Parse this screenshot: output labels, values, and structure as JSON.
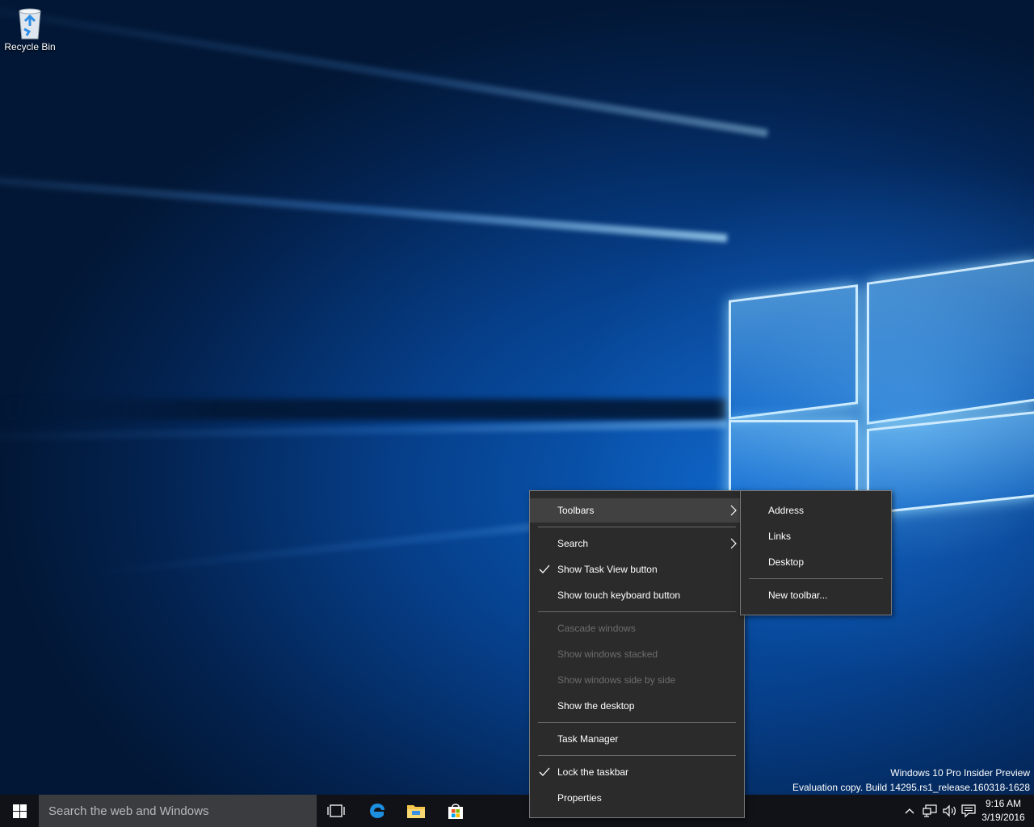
{
  "desktop": {
    "icons": [
      {
        "label": "Recycle Bin",
        "icon": "recycle-bin-icon"
      }
    ],
    "watermark": {
      "line1": "Windows 10 Pro Insider Preview",
      "line2": "Evaluation copy. Build 14295.rs1_release.160318-1628"
    }
  },
  "taskbar": {
    "start_icon": "windows-logo-icon",
    "search": {
      "placeholder": "Search the web and Windows"
    },
    "apps": [
      {
        "name": "task-view-icon"
      },
      {
        "name": "edge-icon"
      },
      {
        "name": "file-explorer-icon"
      },
      {
        "name": "store-icon"
      }
    ],
    "tray": {
      "icons": [
        "chevron-up-icon",
        "network-icon",
        "volume-icon",
        "action-center-icon"
      ],
      "time": "9:16 AM",
      "date": "3/19/2016"
    }
  },
  "context_menu": {
    "items": [
      {
        "label": "Toolbars",
        "submenu": true,
        "highlighted": true
      },
      {
        "label": "Search",
        "submenu": true
      },
      {
        "label": "Show Task View button",
        "checked": true
      },
      {
        "label": "Show touch keyboard button"
      },
      {
        "label": "Cascade windows",
        "disabled": true
      },
      {
        "label": "Show windows stacked",
        "disabled": true
      },
      {
        "label": "Show windows side by side",
        "disabled": true
      },
      {
        "label": "Show the desktop"
      },
      {
        "label": "Task Manager"
      },
      {
        "label": "Lock the taskbar",
        "checked": true
      },
      {
        "label": "Properties"
      }
    ]
  },
  "toolbars_submenu": {
    "items": [
      {
        "label": "Address"
      },
      {
        "label": "Links"
      },
      {
        "label": "Desktop"
      },
      {
        "label": "New toolbar..."
      }
    ]
  },
  "colors": {
    "taskbar": "#101218",
    "menu_bg": "#2b2b2b",
    "menu_highlight": "#414141",
    "disabled_text": "#6d6d6d",
    "accent": "#0078d7"
  }
}
